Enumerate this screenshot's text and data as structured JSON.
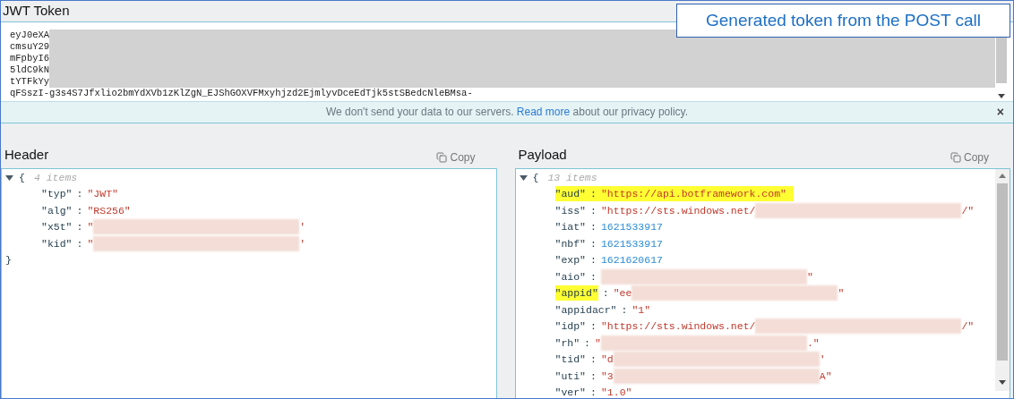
{
  "token": {
    "title": "JWT Token",
    "lines": [
      {
        "text": "eyJ0eXA",
        "redacted": true
      },
      {
        "text": "cmsuY29",
        "redacted": true
      },
      {
        "text": "mFpbyI6",
        "redacted": true
      },
      {
        "text": "5ldC9kN",
        "redacted": true
      },
      {
        "text": "tYTFkYy",
        "redacted": true
      },
      {
        "text": "qFSszI-g3s4S7Jfxlio2bmYdXVb1zKlZgN_EJShGOXVFMxyhjzd2EjmlyvDceEdTjk5stSBedcNleBMsa-",
        "redacted": false
      }
    ],
    "notice": {
      "before": "We don't send your data to our servers.",
      "link": "Read more",
      "after": "about our privacy policy.",
      "close": "×"
    }
  },
  "callout": "Generated token from the POST call",
  "header": {
    "title": "Header",
    "copy": "Copy",
    "open": "{",
    "count": "4 items",
    "close": "}",
    "rows": [
      {
        "key": "\"typ\"",
        "colon": ":",
        "key_highlighted": false,
        "value_highlighted": false,
        "parts": [
          {
            "kind": "string",
            "text": "\"JWT\""
          }
        ]
      },
      {
        "key": "\"alg\"",
        "colon": ":",
        "key_highlighted": false,
        "value_highlighted": false,
        "parts": [
          {
            "kind": "string",
            "text": "\"RS256\""
          }
        ]
      },
      {
        "key": "\"x5t\"",
        "colon": ":",
        "key_highlighted": false,
        "value_highlighted": false,
        "parts": [
          {
            "kind": "string",
            "text": "\""
          },
          {
            "kind": "redacted"
          },
          {
            "kind": "string",
            "text": "'"
          }
        ]
      },
      {
        "key": "\"kid\"",
        "colon": ":",
        "key_highlighted": false,
        "value_highlighted": false,
        "parts": [
          {
            "kind": "string",
            "text": "\""
          },
          {
            "kind": "redacted"
          },
          {
            "kind": "string",
            "text": "'"
          }
        ]
      }
    ]
  },
  "payload": {
    "title": "Payload",
    "copy": "Copy",
    "open": "{",
    "count": "13 items",
    "rows": [
      {
        "key": "\"aud\"",
        "colon": ":",
        "key_highlighted": true,
        "value_highlighted": true,
        "parts": [
          {
            "kind": "string",
            "text": "\"https://api.botframework.com\""
          }
        ]
      },
      {
        "key": "\"iss\"",
        "colon": ":",
        "key_highlighted": false,
        "value_highlighted": false,
        "parts": [
          {
            "kind": "string",
            "text": "\"https://sts.windows.net/"
          },
          {
            "kind": "redacted"
          },
          {
            "kind": "string",
            "text": "/\""
          }
        ]
      },
      {
        "key": "\"iat\"",
        "colon": ":",
        "key_highlighted": false,
        "value_highlighted": false,
        "parts": [
          {
            "kind": "number",
            "text": "1621533917"
          }
        ]
      },
      {
        "key": "\"nbf\"",
        "colon": ":",
        "key_highlighted": false,
        "value_highlighted": false,
        "parts": [
          {
            "kind": "number",
            "text": "1621533917"
          }
        ]
      },
      {
        "key": "\"exp\"",
        "colon": ":",
        "key_highlighted": false,
        "value_highlighted": false,
        "parts": [
          {
            "kind": "number",
            "text": "1621620617"
          }
        ]
      },
      {
        "key": "\"aio\"",
        "colon": ":",
        "key_highlighted": false,
        "value_highlighted": false,
        "parts": [
          {
            "kind": "redacted"
          },
          {
            "kind": "string",
            "text": "\""
          }
        ]
      },
      {
        "key": "\"appid\"",
        "colon": ":",
        "key_highlighted": true,
        "value_highlighted": false,
        "parts": [
          {
            "kind": "string",
            "text": "\"ee"
          },
          {
            "kind": "redacted"
          },
          {
            "kind": "string",
            "text": "\""
          }
        ]
      },
      {
        "key": "\"appidacr\"",
        "colon": ":",
        "key_highlighted": false,
        "value_highlighted": false,
        "parts": [
          {
            "kind": "string",
            "text": "\"1\""
          }
        ]
      },
      {
        "key": "\"idp\"",
        "colon": ":",
        "key_highlighted": false,
        "value_highlighted": false,
        "parts": [
          {
            "kind": "string",
            "text": "\"https://sts.windows.net/"
          },
          {
            "kind": "redacted"
          },
          {
            "kind": "string",
            "text": "/\""
          }
        ]
      },
      {
        "key": "\"rh\"",
        "colon": ":",
        "key_highlighted": false,
        "value_highlighted": false,
        "parts": [
          {
            "kind": "string",
            "text": "\""
          },
          {
            "kind": "redacted"
          },
          {
            "kind": "string",
            "text": ".\""
          }
        ]
      },
      {
        "key": "\"tid\"",
        "colon": ":",
        "key_highlighted": false,
        "value_highlighted": false,
        "parts": [
          {
            "kind": "string",
            "text": "\"d"
          },
          {
            "kind": "redacted"
          },
          {
            "kind": "string",
            "text": "'"
          }
        ]
      },
      {
        "key": "\"uti\"",
        "colon": ":",
        "key_highlighted": false,
        "value_highlighted": false,
        "parts": [
          {
            "kind": "string",
            "text": "\"3"
          },
          {
            "kind": "redacted"
          },
          {
            "kind": "string",
            "text": "A\""
          }
        ]
      },
      {
        "key": "\"ver\"",
        "colon": ":",
        "key_highlighted": false,
        "value_highlighted": false,
        "parts": [
          {
            "kind": "string",
            "text": "\"1.0\""
          }
        ]
      }
    ]
  }
}
